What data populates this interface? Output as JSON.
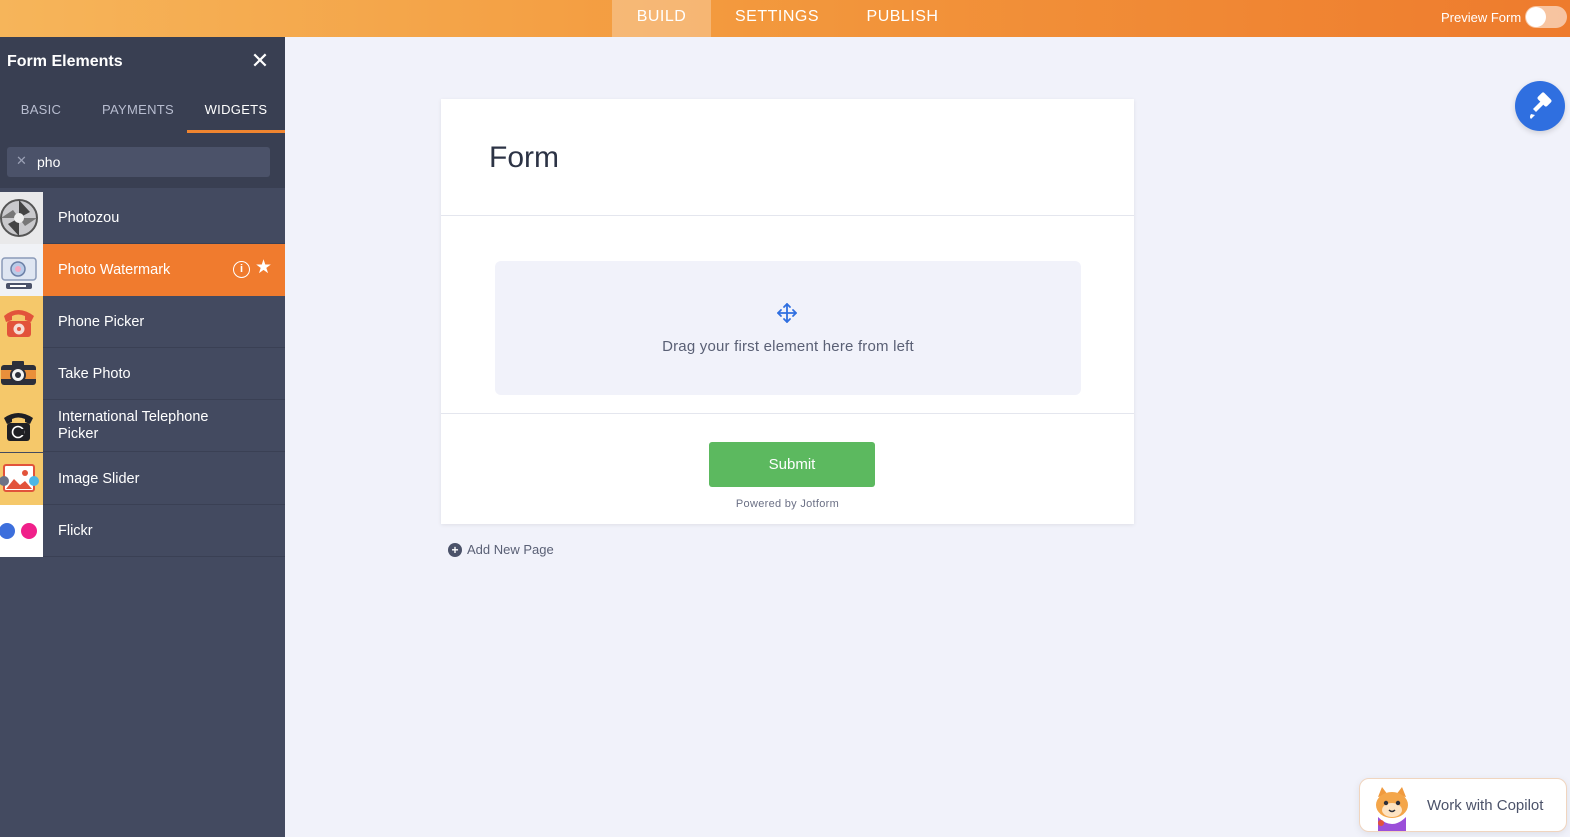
{
  "topbar": {
    "tabs": [
      {
        "label": "BUILD",
        "active": true
      },
      {
        "label": "SETTINGS",
        "active": false
      },
      {
        "label": "PUBLISH",
        "active": false
      }
    ],
    "preview_label": "Preview Form",
    "preview_enabled": false
  },
  "panel": {
    "title": "Form Elements",
    "tabs": [
      {
        "label": "BASIC",
        "active": false
      },
      {
        "label": "PAYMENTS",
        "active": false
      },
      {
        "label": "WIDGETS",
        "active": true
      }
    ],
    "search": {
      "value": "pho",
      "placeholder": ""
    },
    "items": [
      {
        "label": "Photozou",
        "icon": "photozou-icon",
        "active": false
      },
      {
        "label": "Photo Watermark",
        "icon": "camera-watermark-icon",
        "active": true
      },
      {
        "label": "Phone Picker",
        "icon": "telephone-icon",
        "active": false
      },
      {
        "label": "Take Photo",
        "icon": "camera-icon",
        "active": false
      },
      {
        "label": "International Telephone Picker",
        "icon": "black-telephone-icon",
        "active": false
      },
      {
        "label": "Image Slider",
        "icon": "image-slider-icon",
        "active": false
      },
      {
        "label": "Flickr",
        "icon": "flickr-icon",
        "active": false
      }
    ]
  },
  "form": {
    "title": "Form",
    "dropzone_text": "Drag your first element here from left",
    "submit_label": "Submit",
    "powered_by": "Powered by Jotform",
    "add_page_label": "Add New Page"
  },
  "copilot": {
    "label": "Work with Copilot"
  },
  "colors": {
    "accent": "#f07b2e",
    "panel": "#434a60",
    "submit": "#5cb95f",
    "fab": "#2f6fe0"
  }
}
